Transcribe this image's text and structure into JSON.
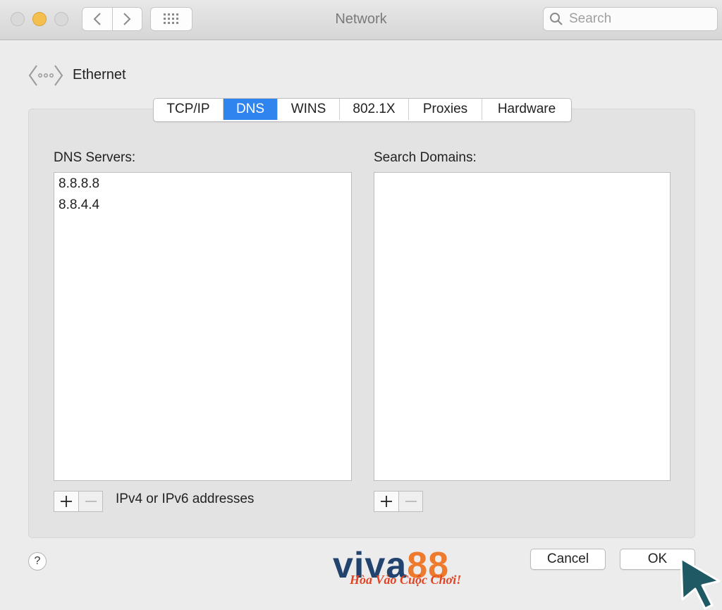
{
  "window": {
    "title": "Network"
  },
  "search": {
    "placeholder": "Search"
  },
  "interface": {
    "name": "Ethernet"
  },
  "tabs": [
    {
      "label": "TCP/IP",
      "active": false
    },
    {
      "label": "DNS",
      "active": true
    },
    {
      "label": "WINS",
      "active": false
    },
    {
      "label": "802.1X",
      "active": false
    },
    {
      "label": "Proxies",
      "active": false
    },
    {
      "label": "Hardware",
      "active": false
    }
  ],
  "dns_servers": {
    "label": "DNS Servers:",
    "entries": [
      "8.8.8.8",
      "8.8.4.4"
    ],
    "hint": "IPv4 or IPv6 addresses"
  },
  "search_domains": {
    "label": "Search Domains:",
    "entries": []
  },
  "footer": {
    "help": "?",
    "cancel_label": "Cancel",
    "ok_label": "OK"
  },
  "watermark": {
    "brand_a": "viva",
    "brand_b": "88",
    "slogan": "Hòa Vào Cuộc Chơi!"
  },
  "colors": {
    "accent": "#2f84ee",
    "brand_blue": "#23436f",
    "brand_orange": "#ee7a2d",
    "cursor": "#1f5a64"
  },
  "icons": [
    "chevron-left-icon",
    "chevron-right-icon",
    "grid-icon",
    "search-icon",
    "ethernet-icon",
    "plus-icon",
    "minus-icon",
    "pointer-cursor-icon"
  ]
}
